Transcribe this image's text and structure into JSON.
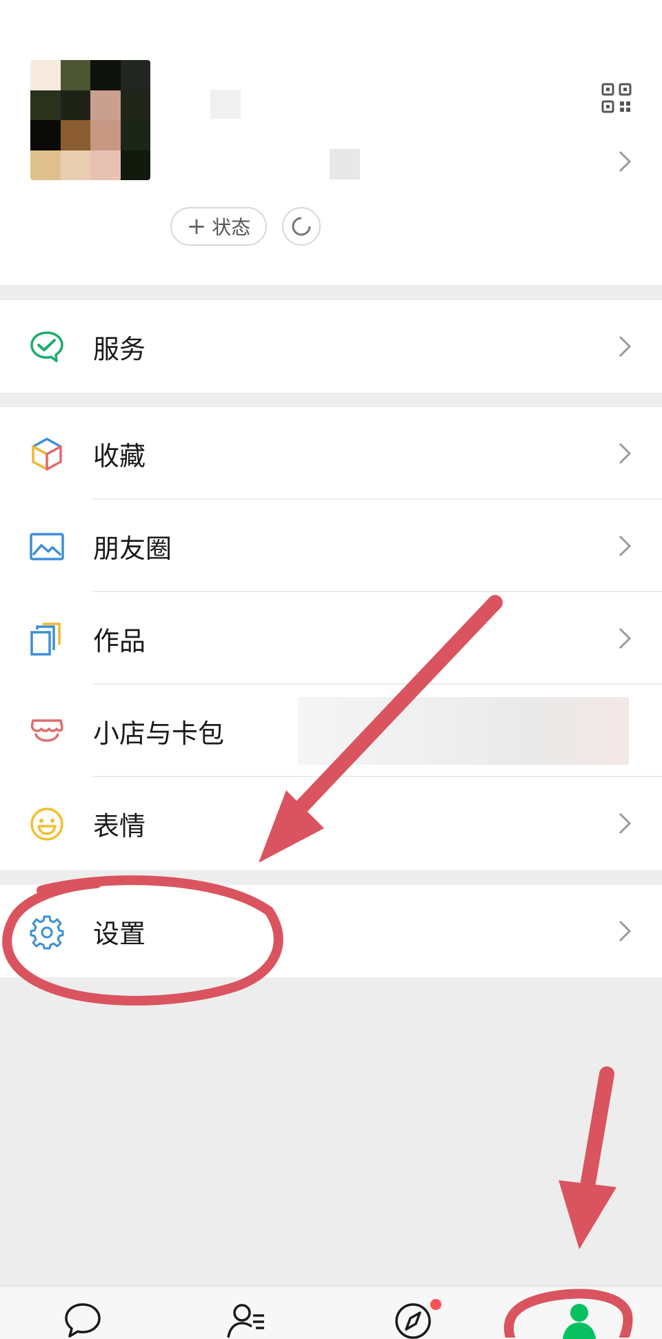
{
  "profile": {
    "status_button_label": "状态",
    "status_button_prefix": "+"
  },
  "menu": {
    "group1": [
      {
        "label": "服务",
        "icon": "service-icon"
      }
    ],
    "group2": [
      {
        "label": "收藏",
        "icon": "favorites-cube-icon"
      },
      {
        "label": "朋友圈",
        "icon": "moments-image-icon"
      },
      {
        "label": "作品",
        "icon": "works-stack-icon"
      },
      {
        "label": "小店与卡包",
        "icon": "shop-awning-icon"
      },
      {
        "label": "表情",
        "icon": "sticker-smile-icon"
      }
    ],
    "group3": [
      {
        "label": "设置",
        "icon": "settings-gear-icon"
      }
    ]
  },
  "tabbar": {
    "tabs": [
      {
        "name": "chats",
        "icon": "chat-bubble-icon"
      },
      {
        "name": "contacts",
        "icon": "contacts-icon"
      },
      {
        "name": "discover",
        "icon": "compass-icon",
        "badge": true
      },
      {
        "name": "me",
        "icon": "person-icon",
        "active": true
      }
    ]
  },
  "colors": {
    "accent": "#07c160",
    "annotation": "#d9545e",
    "badge": "#fa5151",
    "background": "#ededed"
  }
}
